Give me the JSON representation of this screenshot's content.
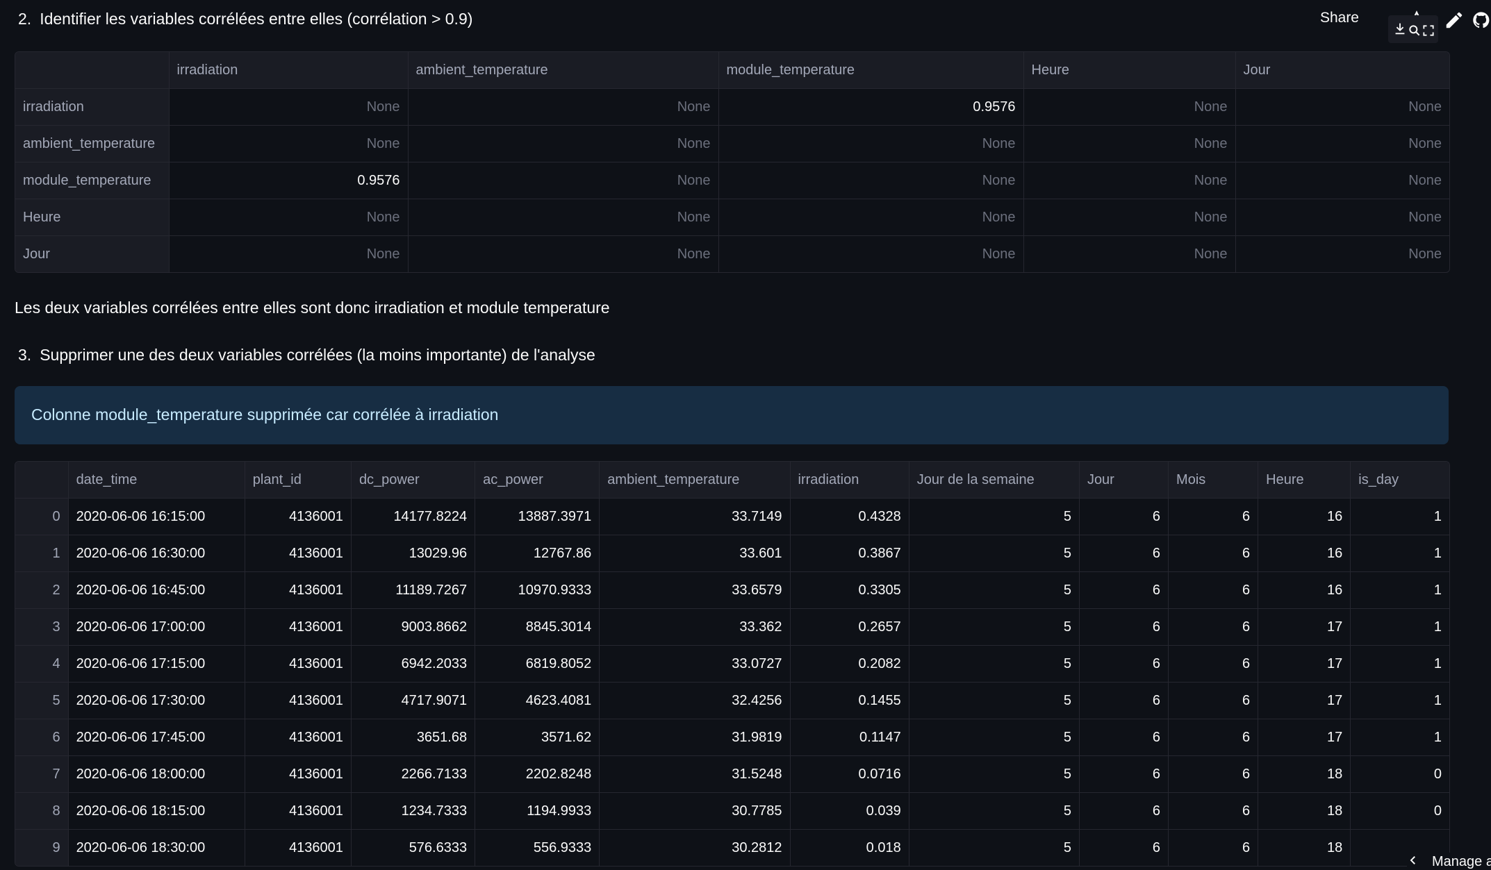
{
  "header": {
    "share_label": "Share",
    "icons": [
      "star-icon",
      "edit-icon",
      "github-icon",
      "download-icon",
      "search-icon",
      "fullscreen-icon"
    ]
  },
  "section2": {
    "number": "2.",
    "title": "Identifier les variables corrélées entre elles (corrélation > 0.9)"
  },
  "corr_table": {
    "columns": [
      "",
      "irradiation",
      "ambient_temperature",
      "module_temperature",
      "Heure",
      "Jour"
    ],
    "rows": [
      {
        "label": "irradiation",
        "cells": [
          "None",
          "None",
          "0.9576",
          "None",
          "None"
        ]
      },
      {
        "label": "ambient_temperature",
        "cells": [
          "None",
          "None",
          "None",
          "None",
          "None"
        ]
      },
      {
        "label": "module_temperature",
        "cells": [
          "0.9576",
          "None",
          "None",
          "None",
          "None"
        ]
      },
      {
        "label": "Heure",
        "cells": [
          "None",
          "None",
          "None",
          "None",
          "None"
        ]
      },
      {
        "label": "Jour",
        "cells": [
          "None",
          "None",
          "None",
          "None",
          "None"
        ]
      }
    ]
  },
  "paragraph": "Les deux variables corrélées entre elles sont donc irradiation et module temperature",
  "section3": {
    "number": "3.",
    "title": "Supprimer une des deux variables corrélées (la moins importante) de l'analyse"
  },
  "info_message": "Colonne module_temperature supprimée car corrélée à irradiation",
  "data_table": {
    "columns": [
      "",
      "date_time",
      "plant_id",
      "dc_power",
      "ac_power",
      "ambient_temperature",
      "irradiation",
      "Jour de la semaine",
      "Jour",
      "Mois",
      "Heure",
      "is_day"
    ],
    "rows": [
      [
        "0",
        "2020-06-06 16:15:00",
        "4136001",
        "14177.8224",
        "13887.3971",
        "33.7149",
        "0.4328",
        "5",
        "6",
        "6",
        "16",
        "1"
      ],
      [
        "1",
        "2020-06-06 16:30:00",
        "4136001",
        "13029.96",
        "12767.86",
        "33.601",
        "0.3867",
        "5",
        "6",
        "6",
        "16",
        "1"
      ],
      [
        "2",
        "2020-06-06 16:45:00",
        "4136001",
        "11189.7267",
        "10970.9333",
        "33.6579",
        "0.3305",
        "5",
        "6",
        "6",
        "16",
        "1"
      ],
      [
        "3",
        "2020-06-06 17:00:00",
        "4136001",
        "9003.8662",
        "8845.3014",
        "33.362",
        "0.2657",
        "5",
        "6",
        "6",
        "17",
        "1"
      ],
      [
        "4",
        "2020-06-06 17:15:00",
        "4136001",
        "6942.2033",
        "6819.8052",
        "33.0727",
        "0.2082",
        "5",
        "6",
        "6",
        "17",
        "1"
      ],
      [
        "5",
        "2020-06-06 17:30:00",
        "4136001",
        "4717.9071",
        "4623.4081",
        "32.4256",
        "0.1455",
        "5",
        "6",
        "6",
        "17",
        "1"
      ],
      [
        "6",
        "2020-06-06 17:45:00",
        "4136001",
        "3651.68",
        "3571.62",
        "31.9819",
        "0.1147",
        "5",
        "6",
        "6",
        "17",
        "1"
      ],
      [
        "7",
        "2020-06-06 18:00:00",
        "4136001",
        "2266.7133",
        "2202.8248",
        "31.5248",
        "0.0716",
        "5",
        "6",
        "6",
        "18",
        "0"
      ],
      [
        "8",
        "2020-06-06 18:15:00",
        "4136001",
        "1234.7333",
        "1194.9933",
        "30.7785",
        "0.039",
        "5",
        "6",
        "6",
        "18",
        "0"
      ],
      [
        "9",
        "2020-06-06 18:30:00",
        "4136001",
        "576.6333",
        "556.9333",
        "30.2812",
        "0.018",
        "5",
        "6",
        "6",
        "18",
        ""
      ]
    ]
  },
  "manage_app_label": "Manage a"
}
